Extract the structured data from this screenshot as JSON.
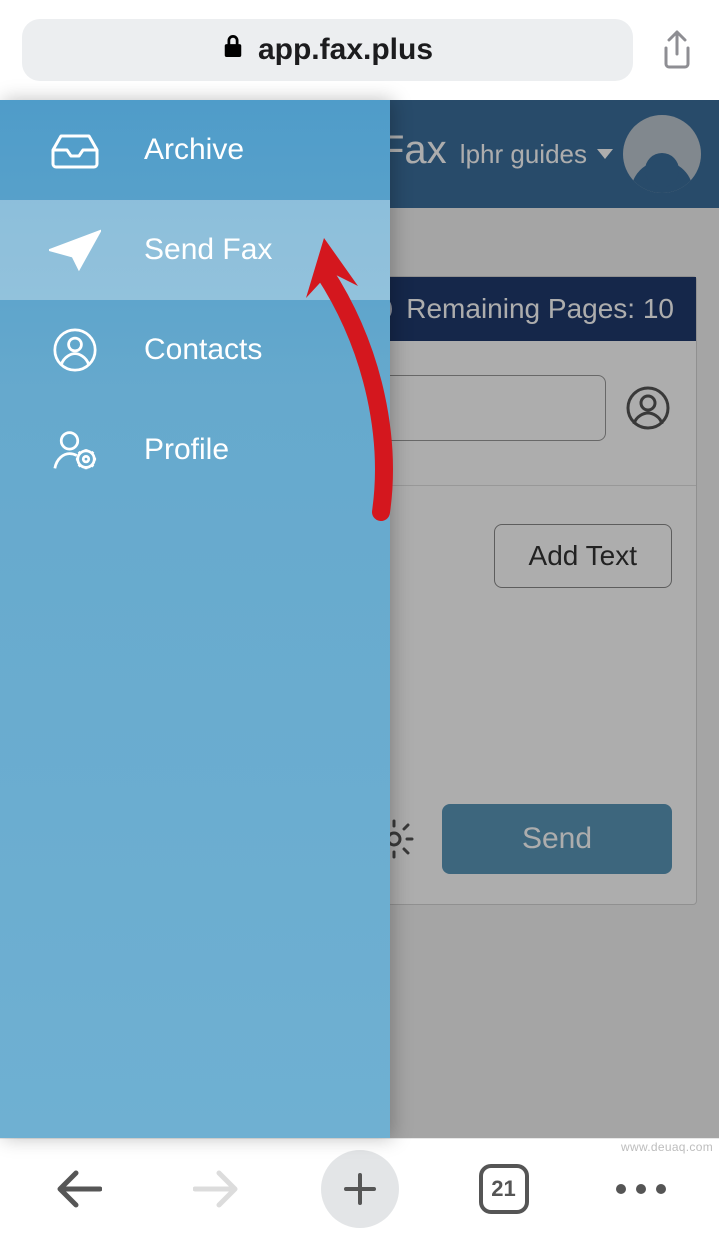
{
  "browser": {
    "url_label": "app.fax.plus",
    "tab_count": "21"
  },
  "sidebar": {
    "items": [
      {
        "label": "Archive"
      },
      {
        "label": "Send Fax"
      },
      {
        "label": "Contacts"
      },
      {
        "label": "Profile"
      }
    ],
    "selected_index": 1
  },
  "header": {
    "logo_text": "Fax",
    "user_label": "lphr guides"
  },
  "main": {
    "remaining_label": "Remaining Pages: 10",
    "add_text_label": "Add Text",
    "send_label": "Send"
  },
  "watermark": "www.deuaq.com"
}
